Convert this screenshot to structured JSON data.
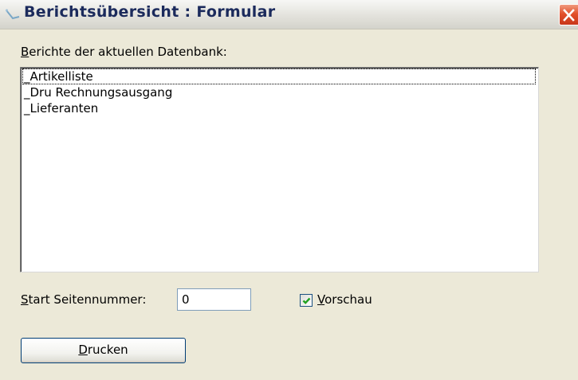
{
  "window": {
    "title": "Berichtsübersicht : Formular",
    "icon": "report-icon",
    "close_icon": "close-icon"
  },
  "reports": {
    "label_accel": "B",
    "label_rest": "erichte der aktuellen Datenbank:",
    "items": [
      {
        "label": "_Artikelliste",
        "focused": true
      },
      {
        "label": "_Dru Rechnungsausgang",
        "focused": false
      },
      {
        "label": "_Lieferanten",
        "focused": false
      }
    ]
  },
  "start_page": {
    "label_accel": "S",
    "label_rest": "tart Seitennummer:",
    "value": "0"
  },
  "preview": {
    "label_accel": "V",
    "label_rest": "orschau",
    "checked": true
  },
  "print_button": {
    "label_accel": "D",
    "label_rest": "rucken"
  },
  "colors": {
    "title_text": "#1b2a5c",
    "dialog_bg": "#ece9d8",
    "checkmark": "#21a121",
    "close_button": "#e2512b"
  }
}
